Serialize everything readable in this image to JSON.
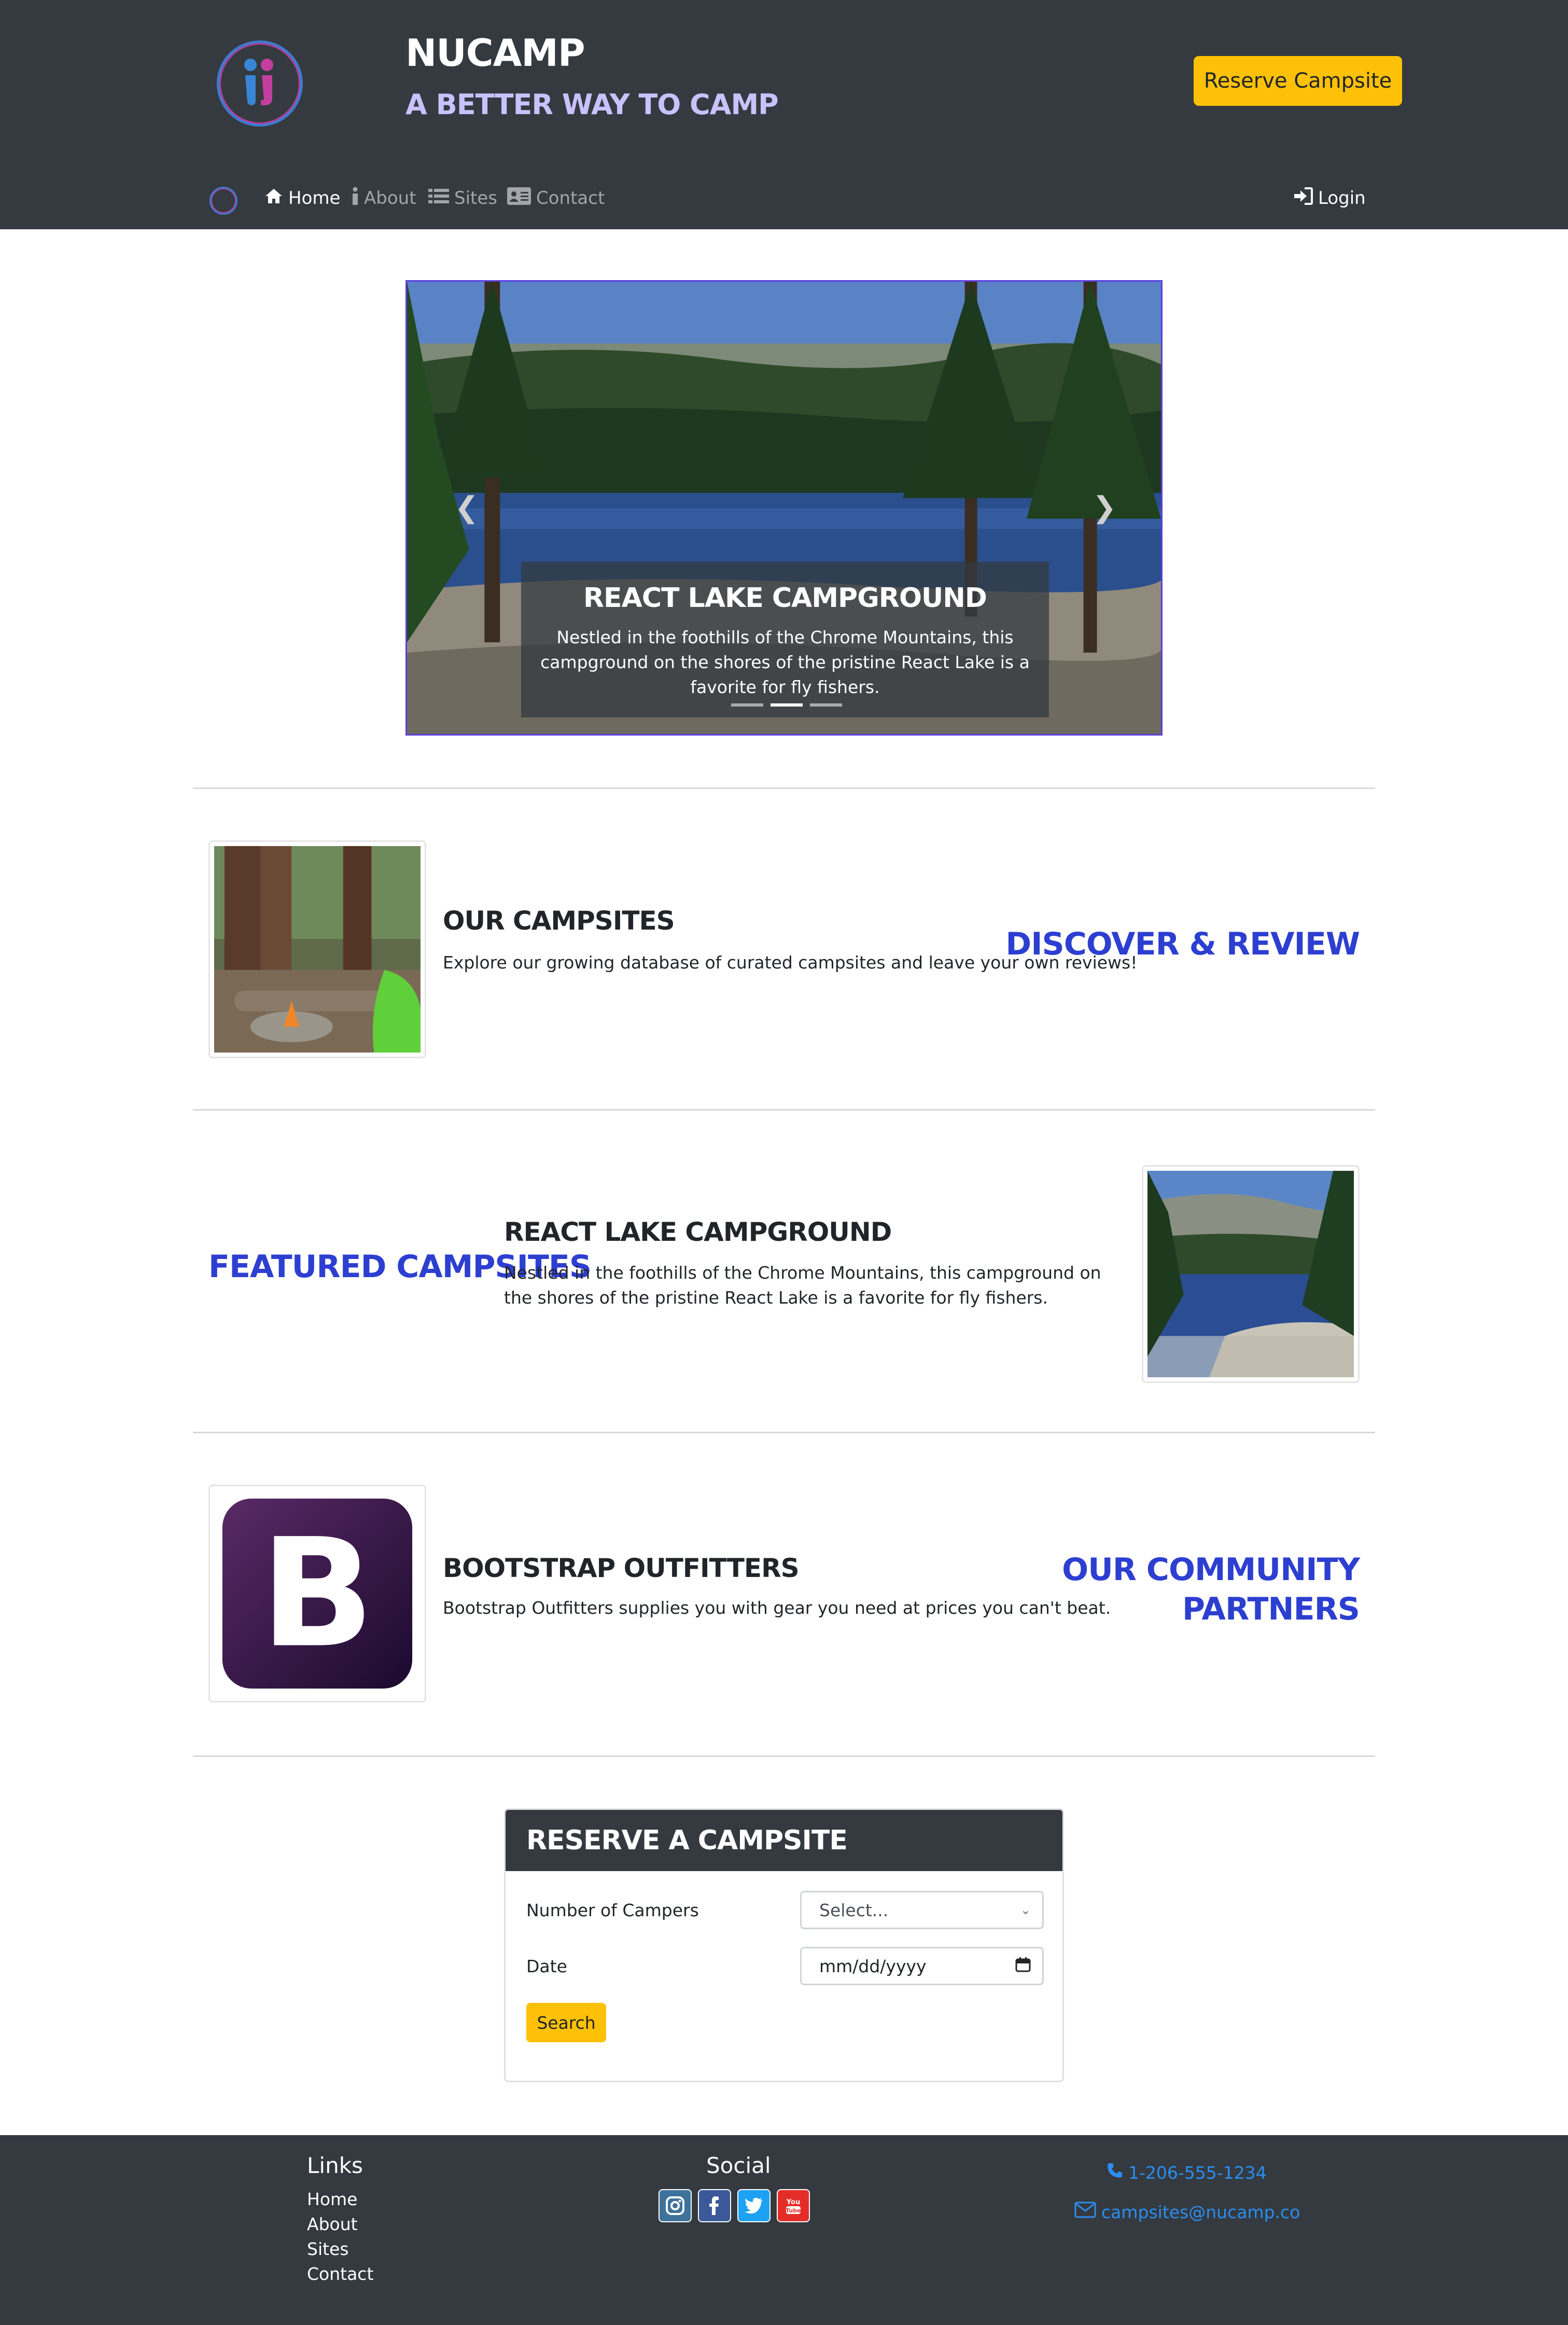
{
  "brand": {
    "title": "NuCamp",
    "subtitle": "A Better Way to Camp",
    "reserve_button": "Reserve Campsite"
  },
  "navbar": {
    "items": [
      {
        "label": "Home",
        "icon": "home-icon",
        "active": true
      },
      {
        "label": "About",
        "icon": "info-icon",
        "active": false
      },
      {
        "label": "Sites",
        "icon": "list-icon",
        "active": false
      },
      {
        "label": "Contact",
        "icon": "address-card-icon",
        "active": false
      }
    ],
    "login": "Login"
  },
  "carousel": {
    "title": "React Lake Campground",
    "text": "Nestled in the foothills of the Chrome Mountains, this campground on the shores of the pristine React Lake is a favorite for fly fishers.",
    "slide_count": 3,
    "active_slide": 2
  },
  "sections": {
    "campsites": {
      "title": "Our Campsites",
      "text": "Explore our growing database of curated campsites and leave your own reviews!",
      "label": "Discover & Review"
    },
    "featured": {
      "label": "Featured Campsites",
      "title": "React Lake Campground",
      "text": "Nestled in the foothills of the Chrome Mountains, this campground on the shores of the pristine React Lake is a favorite for fly fishers."
    },
    "partners": {
      "title": "Bootstrap Outfitters",
      "text": "Bootstrap Outfitters supplies you with gear you need at prices you can't beat.",
      "label_line1": "Our Community",
      "label_line2": "Partners"
    }
  },
  "reserve_form": {
    "heading": "Reserve a Campsite",
    "campers_label": "Number of Campers",
    "campers_value": "Select...",
    "date_label": "Date",
    "date_value": "mm/dd/yyyy",
    "search_button": "Search"
  },
  "footer": {
    "links_heading": "Links",
    "links": [
      "Home",
      "About",
      "Sites",
      "Contact"
    ],
    "social_heading": "Social",
    "social": [
      {
        "name": "instagram-icon",
        "color": "#3f729b"
      },
      {
        "name": "facebook-icon",
        "color": "#3b5998"
      },
      {
        "name": "twitter-icon",
        "color": "#1da1f2"
      },
      {
        "name": "youtube-icon",
        "color": "#e52d27"
      }
    ],
    "phone": "1-206-555-1234",
    "email": "campsites@nucamp.co"
  },
  "colors": {
    "dark": "#343a40",
    "accent_yellow": "#ffc107",
    "heading_blue": "#2d3fd1",
    "subtitle_lavender": "#c9c2ff",
    "link_blue": "#2b8ef0"
  }
}
